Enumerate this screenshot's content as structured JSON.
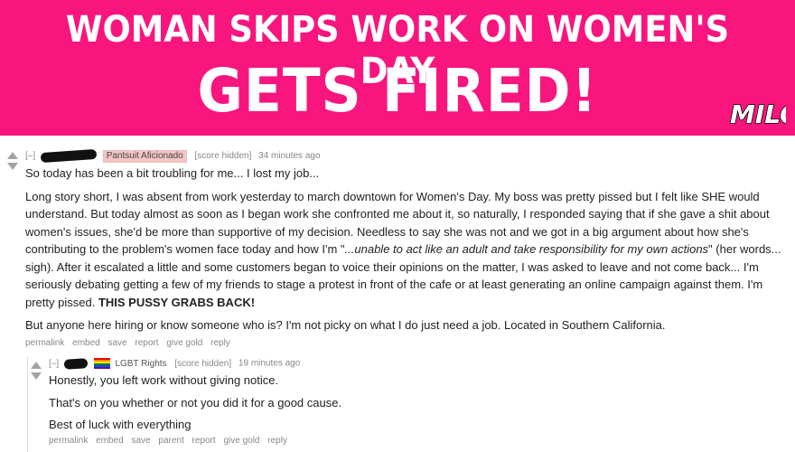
{
  "banner": {
    "line1": "WOMAN SKIPS WORK ON WOMEN'S DAY",
    "line2": "GETS FIRED!",
    "logo": "MILO",
    "background": "#f8157e"
  },
  "comment1": {
    "collapse": "[–]",
    "flair": "Pantsuit Aficionado",
    "score": "[score hidden]",
    "time": "34 minutes ago",
    "first_line": "So today has been a bit troubling for me... I lost my job...",
    "para1_a": "Long story short, I was absent from work yesterday to march downtown for Women's Day. My boss was pretty pissed but I felt like SHE would understand. But today almost as soon as I began work she confronted me about it, so naturally, I responded saying that if she gave a shit about women's issues, she'd be more than supportive of my decision. Needless to say she was not and we got in a big argument about how she's contributing to the problem's women face today and how I'm \"",
    "para1_italic": "...unable to act like an adult and take responsibility for my own actions",
    "para1_b": "\" (her words... sigh). After it escalated a little and some customers began to voice their opinions on the matter, I was asked to leave and not come back... I'm seriously debating getting a few of my friends to stage a protest in front of the cafe or at least generating an online campaign against them. I'm pretty pissed. ",
    "para1_bold": "THIS PUSSY GRABS BACK!",
    "para2": "But anyone here hiring or know someone who is? I'm not picky on what I do just need a job. Located in Southern California.",
    "actions": [
      "permalink",
      "embed",
      "save",
      "report",
      "give gold",
      "reply"
    ]
  },
  "comment2": {
    "collapse": "[–]",
    "flair": "LGBT Rights",
    "score": "[score hidden]",
    "time": "19 minutes ago",
    "lines": [
      "Honestly, you left work without giving notice.",
      "That's on you whether or not you did it for a good cause.",
      "Best of luck with everything"
    ],
    "actions": [
      "permalink",
      "embed",
      "save",
      "parent",
      "report",
      "give gold",
      "reply"
    ]
  }
}
